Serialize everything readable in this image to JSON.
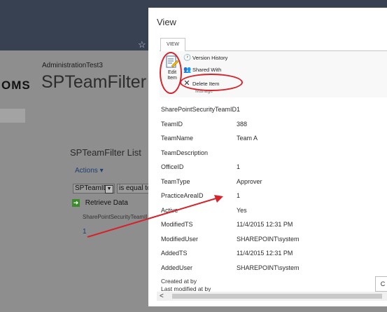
{
  "background": {
    "star": "☆",
    "breadcrumbs": [
      "Administration",
      "Test3"
    ],
    "brand": "OMS",
    "page_title": "SPTeamFilter",
    "list_title": "SPTeamFilter List",
    "actions_label": "Actions ▾",
    "filter_field": "SPTeamID",
    "filter_operator": "is equal to",
    "retrieve_label": "Retrieve Data",
    "column_header": "SharePointSecurityTeamID",
    "cell_value": "1"
  },
  "dialog": {
    "title": "View",
    "tab": "VIEW",
    "ribbon": {
      "edit_label_line1": "Edit",
      "edit_label_line2": "Item",
      "version_history": "Version History",
      "shared_with": "Shared With",
      "delete_item": "Delete Item",
      "group_label": "Manage"
    },
    "properties": [
      {
        "label": "SharePointSecurityTeamID",
        "value": "1"
      },
      {
        "label": "TeamID",
        "value": "388"
      },
      {
        "label": "TeamName",
        "value": "Team A"
      },
      {
        "label": "TeamDescription",
        "value": ""
      },
      {
        "label": "OfficeID",
        "value": "1"
      },
      {
        "label": "TeamType",
        "value": "Approver"
      },
      {
        "label": "PracticeAreaID",
        "value": "1"
      },
      {
        "label": "Active",
        "value": "Yes"
      },
      {
        "label": "ModifiedTS",
        "value": "11/4/2015 12:31 PM"
      },
      {
        "label": "ModifiedUser",
        "value": "SHAREPOINT\\system"
      },
      {
        "label": "AddedTS",
        "value": "11/4/2015 12:31 PM"
      },
      {
        "label": "AddedUser",
        "value": "SHAREPOINT\\system"
      }
    ],
    "created_at_by": "Created at by",
    "modified_at_by": "Last modified at by",
    "close_label": "C",
    "scroll_left": "<"
  },
  "colors": {
    "topbar": "#374152",
    "overlay": "#8e8e8e",
    "annotation_red": "#d4232a",
    "link_blue": "#1d3f73"
  }
}
